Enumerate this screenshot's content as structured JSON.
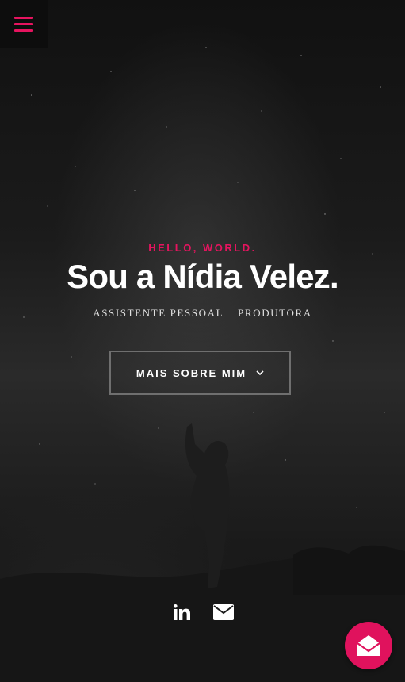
{
  "menu": {
    "icon": "hamburger-menu-icon"
  },
  "hero": {
    "tagline": "HELLO, WORLD.",
    "headline": "Sou a Nídia Velez.",
    "roles": [
      "ASSISTENTE PESSOAL",
      "PRODUTORA"
    ],
    "cta_label": "MAIS SOBRE MIM",
    "cta_icon": "chevron-down-icon"
  },
  "social": [
    {
      "icon": "linkedin-icon"
    },
    {
      "icon": "envelope-icon"
    }
  ],
  "fab": {
    "icon": "open-envelope-icon"
  },
  "colors": {
    "accent": "#e6145f",
    "background": "#1c1c1c",
    "text": "#ffffff"
  }
}
